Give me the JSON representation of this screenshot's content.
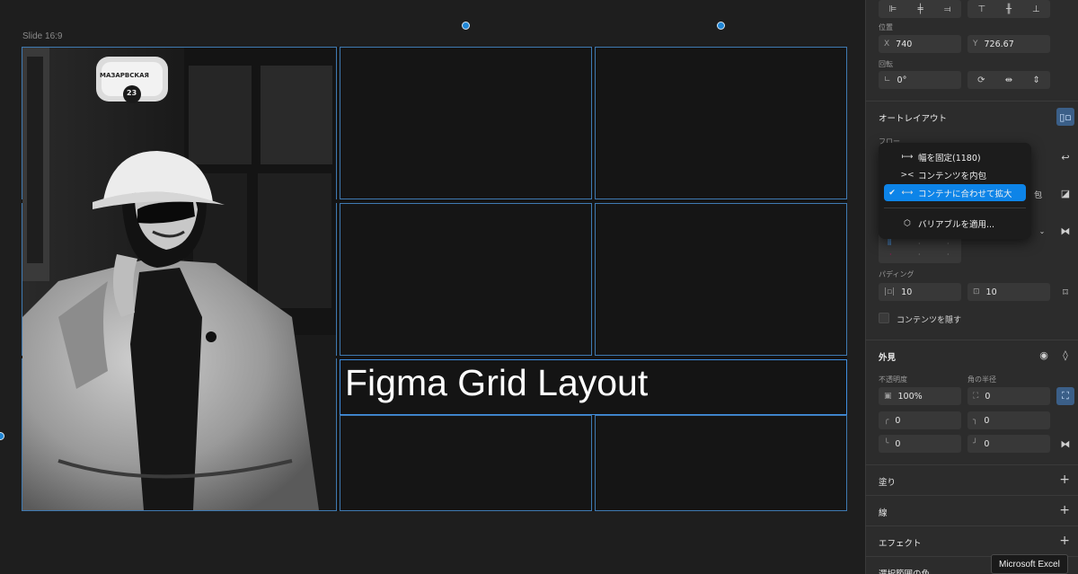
{
  "canvas": {
    "frame_label": "Slide 16:9",
    "slide_title": "Figma Grid Layout",
    "photo_sign_text": "МАЗАРВСКАЯ",
    "photo_sign_number": "23"
  },
  "panel": {
    "position_label": "位置",
    "x_prefix": "X",
    "x_value": "740",
    "y_prefix": "Y",
    "y_value": "726.67",
    "rotation_label": "回転",
    "rotation_value": "0°",
    "autolayout_title": "オートレイアウト",
    "flow_label": "フロー",
    "partial_right_label": "包",
    "padding_label": "パディング",
    "padding_h": "10",
    "padding_v": "10",
    "hide_content_label": "コンテンツを隠す",
    "appearance_title": "外見",
    "opacity_label": "不透明度",
    "corner_radius_label": "角の半径",
    "opacity_value": "100%",
    "radius_value": "0",
    "radius_tl": "0",
    "radius_tr": "0",
    "radius_bl": "0",
    "radius_br": "0",
    "fill_title": "塗り",
    "stroke_title": "線",
    "effects_title": "エフェクト",
    "selection_colors_title": "選択範囲の色"
  },
  "menu": {
    "items": [
      {
        "label": "幅を固定(1180)",
        "icon": "fixed-width-icon",
        "selected": false
      },
      {
        "label": "コンテンツを内包",
        "icon": "hug-contents-icon",
        "selected": false
      },
      {
        "label": "コンテナに合わせて拡大",
        "icon": "fill-container-icon",
        "selected": true
      },
      {
        "label": "バリアブルを適用...",
        "icon": "variable-hexagon-icon",
        "selected": false
      }
    ]
  },
  "tooltip": "Microsoft Excel",
  "colors": {
    "accent": "#0d84e8",
    "grid_stroke": "#3f7ab2",
    "panel_bg": "#2c2c2c"
  }
}
